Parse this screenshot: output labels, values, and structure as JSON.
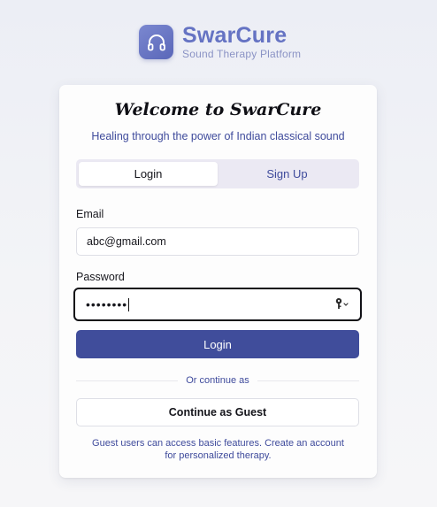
{
  "brand": {
    "name": "SwarCure",
    "tagline": "Sound Therapy Platform",
    "icon": "headphones-icon",
    "accent_color": "#6573c3"
  },
  "card": {
    "title": "Welcome to SwarCure",
    "subtitle": "Healing through the power of Indian classical sound"
  },
  "tabs": [
    {
      "label": "Login",
      "active": true
    },
    {
      "label": "Sign Up",
      "active": false
    }
  ],
  "form": {
    "email_label": "Email",
    "email_value": "abc@gmail.com",
    "password_label": "Password",
    "password_masked": "••••••••",
    "password_manager_icon": "key-icon",
    "submit_label": "Login",
    "primary_color": "#404d9b"
  },
  "alt": {
    "divider_text": "Or continue as",
    "guest_label": "Continue as Guest",
    "note": "Guest users can access basic features. Create an account for personalized therapy."
  }
}
